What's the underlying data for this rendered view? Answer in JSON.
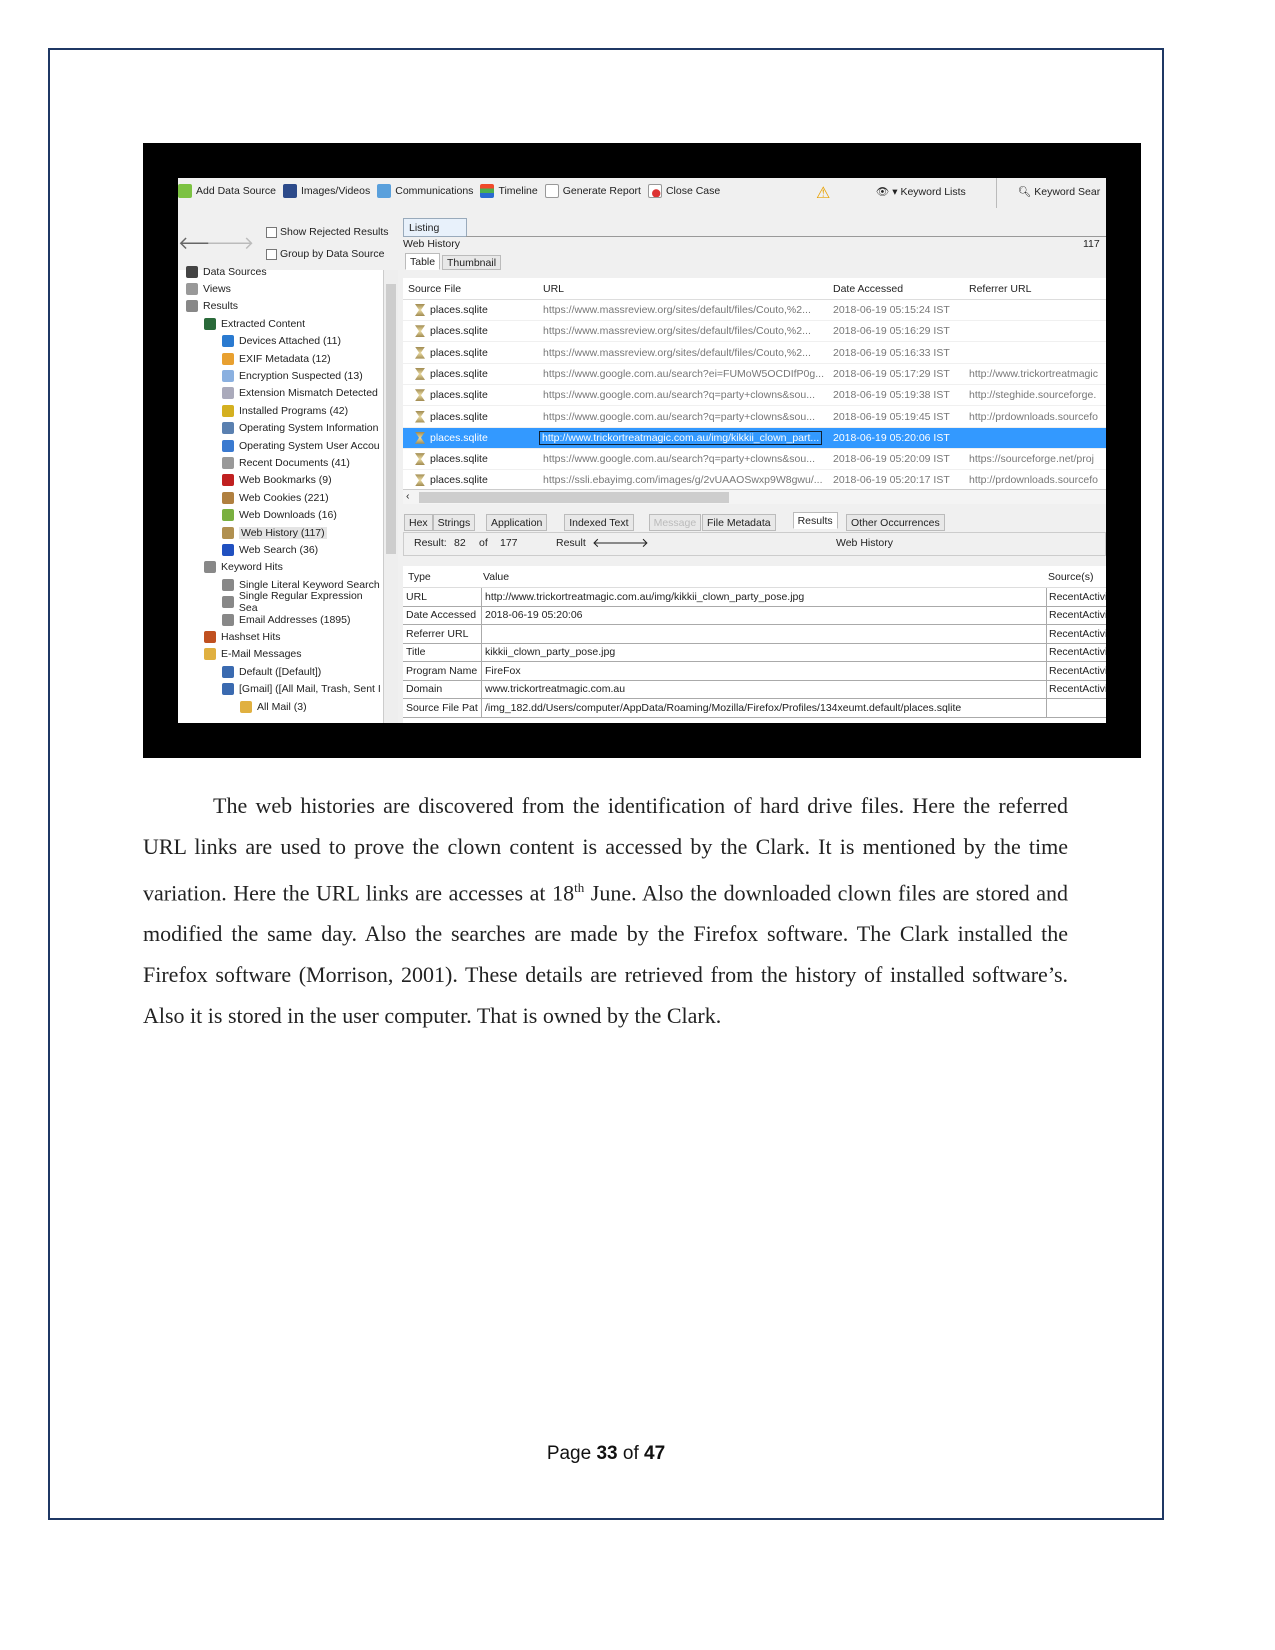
{
  "toolbar": {
    "items": [
      "Add Data Source",
      "Images/Videos",
      "Communications",
      "Timeline",
      "Generate Report",
      "Close Case"
    ],
    "keyword_lists": "Keyword Lists",
    "keyword_search": "Keyword Sear"
  },
  "filters": {
    "show_rejected": "Show Rejected Results",
    "group_by": "Group by Data Source"
  },
  "tree": [
    {
      "label": "Data Sources",
      "level": 0
    },
    {
      "label": "Views",
      "level": 0
    },
    {
      "label": "Results",
      "level": 0
    },
    {
      "label": "Extracted Content",
      "level": 1
    },
    {
      "label": "Devices Attached (11)",
      "level": 2
    },
    {
      "label": "EXIF Metadata (12)",
      "level": 2
    },
    {
      "label": "Encryption Suspected (13)",
      "level": 2
    },
    {
      "label": "Extension Mismatch Detected",
      "level": 2
    },
    {
      "label": "Installed Programs (42)",
      "level": 2
    },
    {
      "label": "Operating System Information",
      "level": 2
    },
    {
      "label": "Operating System User Accou",
      "level": 2
    },
    {
      "label": "Recent Documents (41)",
      "level": 2
    },
    {
      "label": "Web Bookmarks (9)",
      "level": 2
    },
    {
      "label": "Web Cookies (221)",
      "level": 2
    },
    {
      "label": "Web Downloads (16)",
      "level": 2
    },
    {
      "label": "Web History (117)",
      "level": 2,
      "selected": true
    },
    {
      "label": "Web Search (36)",
      "level": 2
    },
    {
      "label": "Keyword Hits",
      "level": 1
    },
    {
      "label": "Single Literal Keyword Search",
      "level": 2
    },
    {
      "label": "Single Regular Expression Sea",
      "level": 2
    },
    {
      "label": "Email Addresses (1895)",
      "level": 2
    },
    {
      "label": "Hashset Hits",
      "level": 1
    },
    {
      "label": "E-Mail Messages",
      "level": 1
    },
    {
      "label": "Default ([Default])",
      "level": 2
    },
    {
      "label": "[Gmail] ([All Mail, Trash, Sent I",
      "level": 2
    },
    {
      "label": "All Mail (3)",
      "level": 3
    }
  ],
  "listing": {
    "tab": "Listing",
    "title": "Web History",
    "count": "117",
    "view_tabs": [
      "Table",
      "Thumbnail"
    ],
    "columns": [
      "Source File",
      "URL",
      "Date Accessed",
      "Referrer URL"
    ],
    "rows": [
      [
        "places.sqlite",
        "https://www.massreview.org/sites/default/files/Couto,%2...",
        "2018-06-19 05:15:24 IST",
        ""
      ],
      [
        "places.sqlite",
        "https://www.massreview.org/sites/default/files/Couto,%2...",
        "2018-06-19 05:16:29 IST",
        ""
      ],
      [
        "places.sqlite",
        "https://www.massreview.org/sites/default/files/Couto,%2...",
        "2018-06-19 05:16:33 IST",
        ""
      ],
      [
        "places.sqlite",
        "https://www.google.com.au/search?ei=FUMoW5OCDIfP0g...",
        "2018-06-19 05:17:29 IST",
        "http://www.trickortreatmagic"
      ],
      [
        "places.sqlite",
        "https://www.google.com.au/search?q=party+clowns&sou...",
        "2018-06-19 05:19:38 IST",
        "http://steghide.sourceforge."
      ],
      [
        "places.sqlite",
        "https://www.google.com.au/search?q=party+clowns&sou...",
        "2018-06-19 05:19:45 IST",
        "http://prdownloads.sourcefo"
      ],
      [
        "places.sqlite",
        "http://www.trickortreatmagic.com.au/img/kikkii_clown_part...",
        "2018-06-19 05:20:06 IST",
        ""
      ],
      [
        "places.sqlite",
        "https://www.google.com.au/search?q=party+clowns&sou...",
        "2018-06-19 05:20:09 IST",
        "https://sourceforge.net/proj"
      ],
      [
        "places.sqlite",
        "https://ssli.ebayimg.com/images/g/2vUAAOSwxp9W8gwu/...",
        "2018-06-19 05:20:17 IST",
        "http://prdownloads.sourcefo"
      ]
    ],
    "selected_row": 6
  },
  "viewer": {
    "tabs": [
      "Hex",
      "Strings",
      "Application",
      "Indexed Text",
      "Message",
      "File Metadata",
      "Results",
      "Other Occurrences"
    ],
    "active_tab": "Results",
    "result_label": "Result:",
    "result_index": "82",
    "of_label": "of",
    "result_total": "177",
    "nav_label": "Result",
    "artifact_type": "Web History",
    "columns": [
      "Type",
      "Value",
      "Source(s)"
    ],
    "rows": [
      [
        "URL",
        "http://www.trickortreatmagic.com.au/img/kikkii_clown_party_pose.jpg",
        "RecentActivi"
      ],
      [
        "Date Accessed",
        "2018-06-19 05:20:06",
        "RecentActivi"
      ],
      [
        "Referrer URL",
        "",
        "RecentActivi"
      ],
      [
        "Title",
        "kikkii_clown_party_pose.jpg",
        "RecentActivi"
      ],
      [
        "Program Name",
        "FireFox",
        "RecentActivi"
      ],
      [
        "Domain",
        "www.trickortreatmagic.com.au",
        "RecentActivi"
      ],
      [
        "Source File Pat",
        "/img_182.dd/Users/computer/AppData/Roaming/Mozilla/Firefox/Profiles/134xeumt.default/places.sqlite",
        ""
      ]
    ]
  },
  "paragraph": {
    "part1": "The web histories are discovered from the identification of hard drive files. Here the referred URL links are used to prove the clown content is accessed by the Clark. It is mentioned by the time variation. Here the URL links are accesses at 18",
    "sup": "th",
    "part2": " June. Also the downloaded clown files are stored and modified the same day. Also the searches are made by the Firefox software. The Clark installed the Firefox software (Morrison, 2001). These details are retrieved from the history of installed software’s. Also it is stored in the user computer. That is owned by the Clark."
  },
  "footer": {
    "page_label": "Page",
    "page": "33",
    "of_label": "of",
    "total": "47"
  },
  "colors": {
    "selection": "#3399ff",
    "border": "#1f3864"
  }
}
